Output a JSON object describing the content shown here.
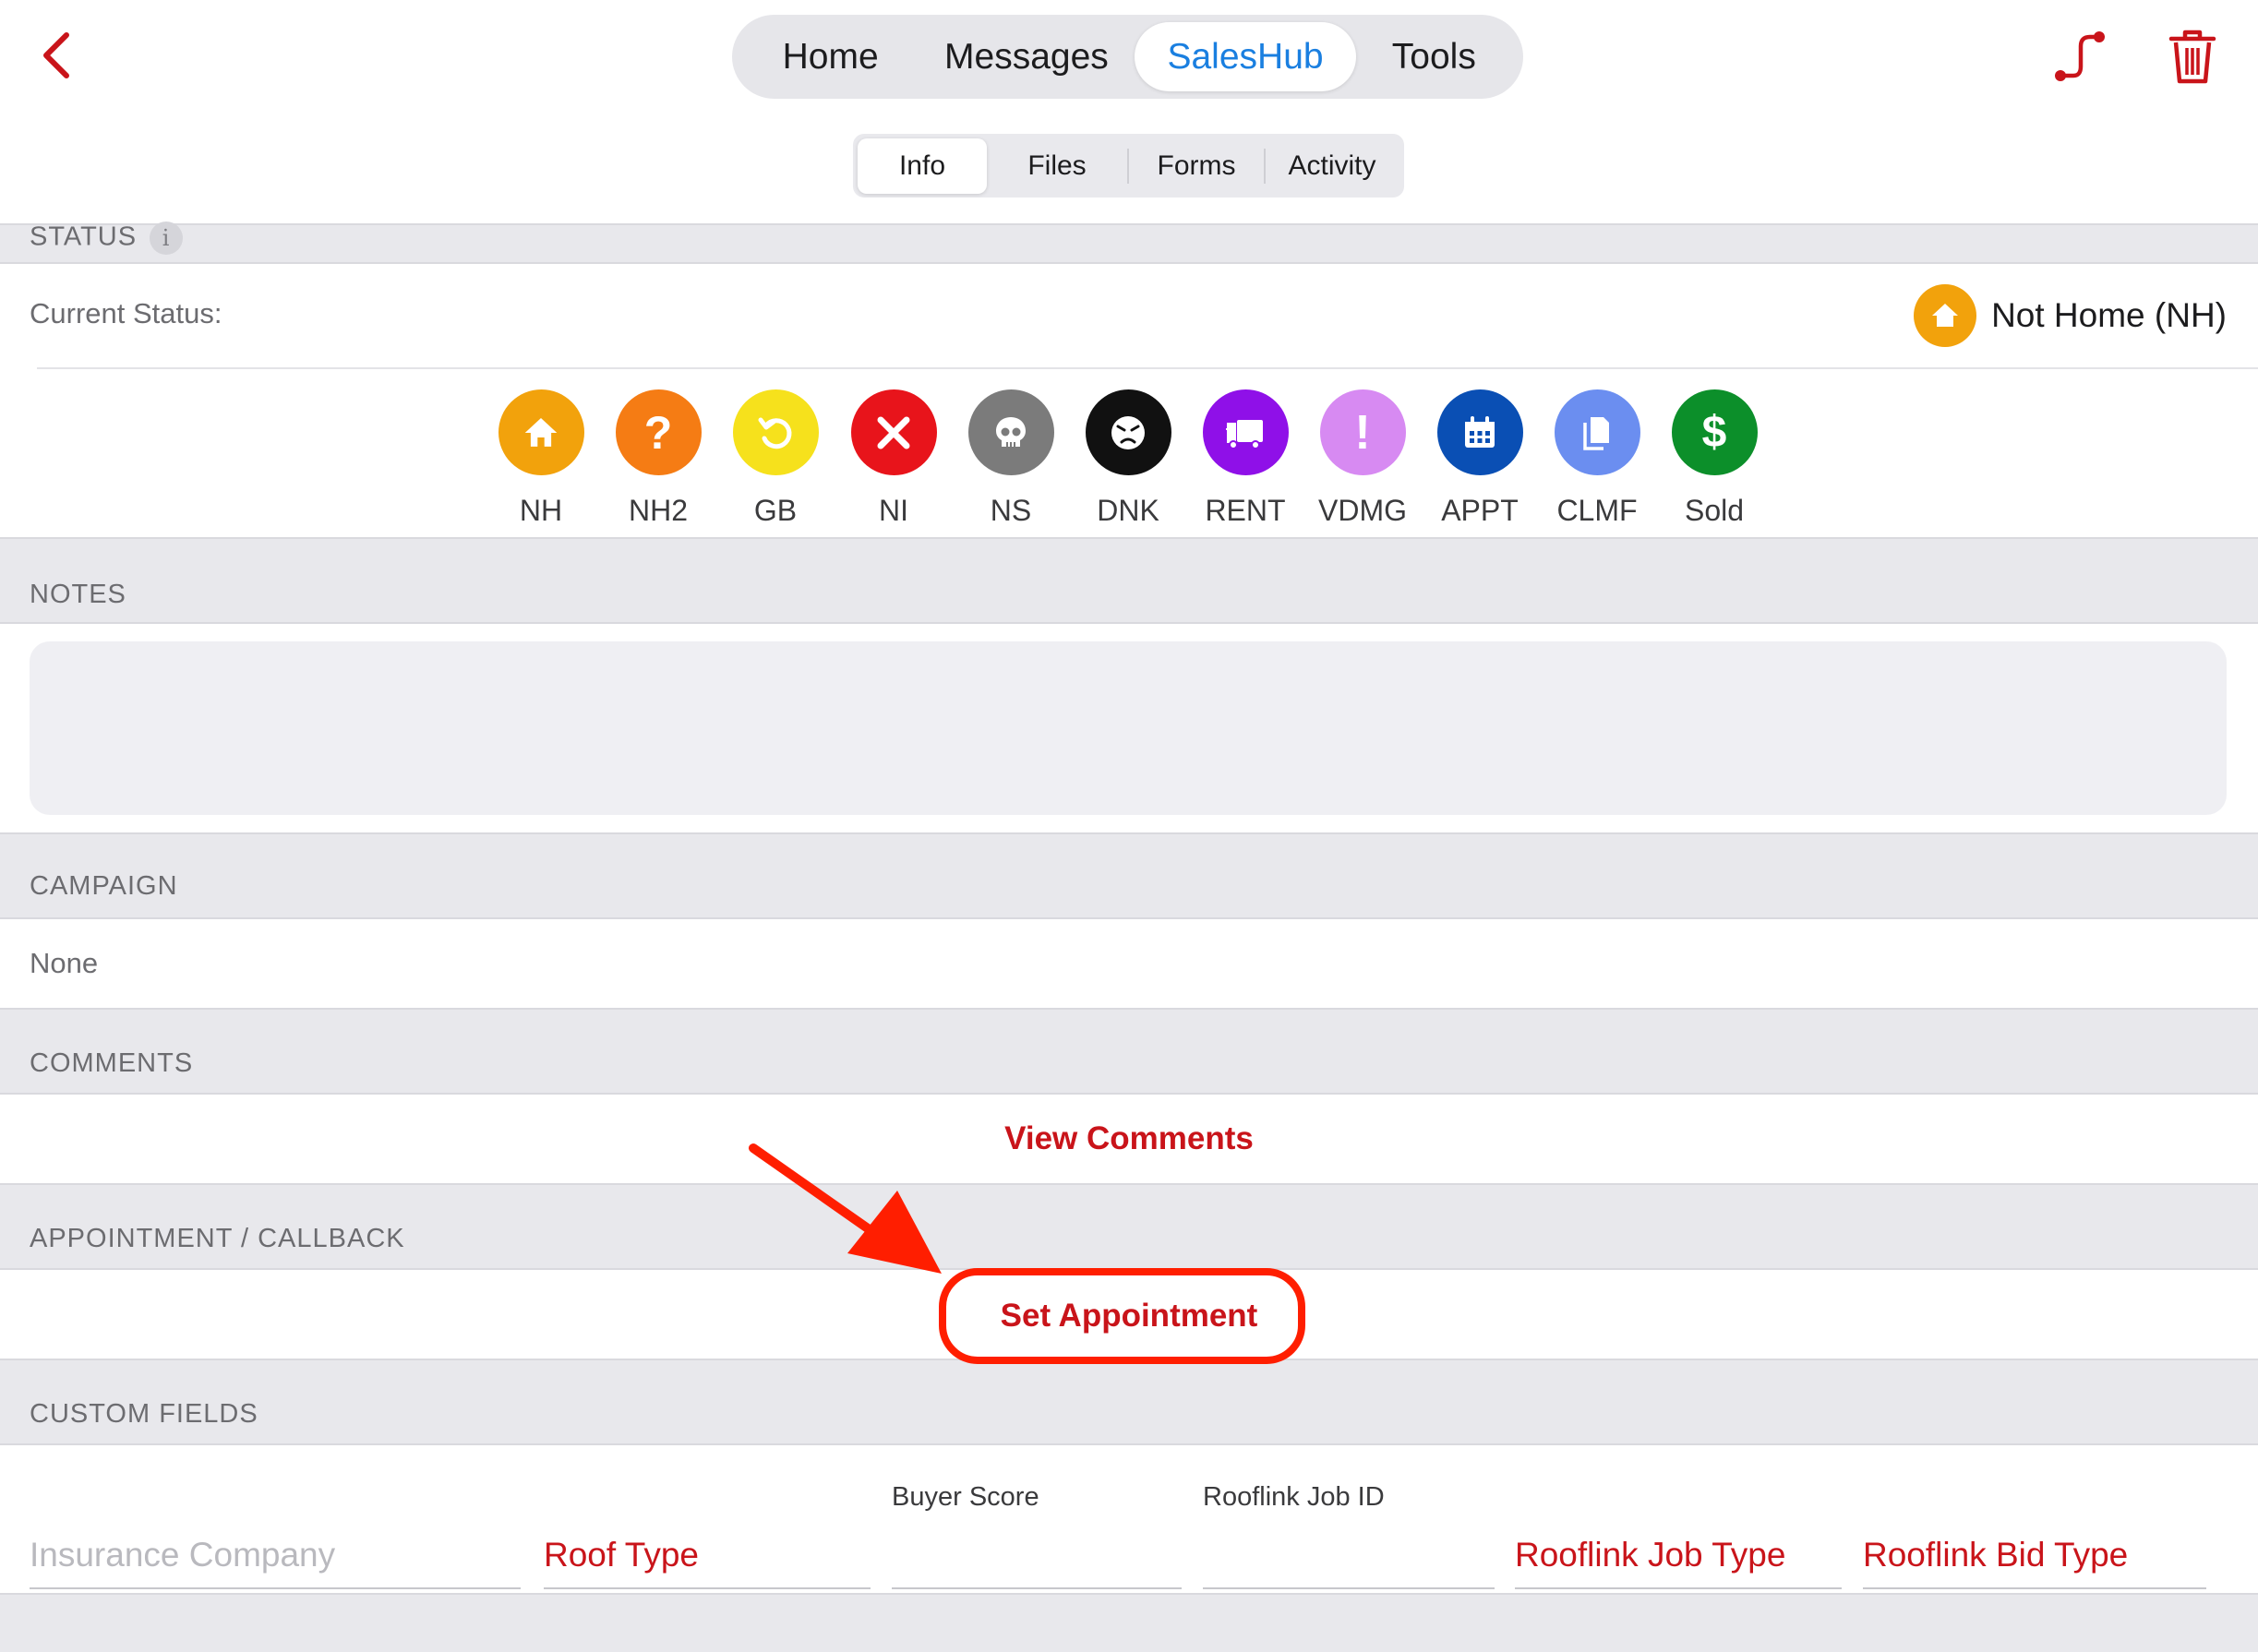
{
  "colors": {
    "accent_red": "#c9141a",
    "accent_blue": "#1a7fe0",
    "annotation": "#ff1e00"
  },
  "header": {
    "back_icon": "chevron-left-icon",
    "main_tabs": [
      {
        "label": "Home",
        "active": false
      },
      {
        "label": "Messages",
        "active": false
      },
      {
        "label": "SalesHub",
        "active": true
      },
      {
        "label": "Tools",
        "active": false
      }
    ],
    "sub_tabs": [
      {
        "label": "Info",
        "active": true
      },
      {
        "label": "Files",
        "active": false
      },
      {
        "label": "Forms",
        "active": false
      },
      {
        "label": "Activity",
        "active": false
      }
    ],
    "route_icon": "route-icon",
    "delete_icon": "trash-icon"
  },
  "status": {
    "section_label": "STATUS",
    "info_badge": "i",
    "current_label": "Current Status:",
    "current_value": "Not Home (NH)",
    "options": [
      {
        "code": "NH",
        "color": "#f2a20c",
        "icon": "home-icon"
      },
      {
        "code": "NH2",
        "color": "#f57c14",
        "icon": "question-icon"
      },
      {
        "code": "GB",
        "color": "#f6e11c",
        "icon": "refresh-icon"
      },
      {
        "code": "NI",
        "color": "#e8141b",
        "icon": "x-icon"
      },
      {
        "code": "NS",
        "color": "#7b7b7b",
        "icon": "skull-icon"
      },
      {
        "code": "DNK",
        "color": "#111111",
        "icon": "angry-face-icon"
      },
      {
        "code": "RENT",
        "color": "#8f10e8",
        "icon": "truck-icon"
      },
      {
        "code": "VDMG",
        "color": "#d78af2",
        "icon": "exclamation-icon"
      },
      {
        "code": "APPT",
        "color": "#0a4fb4",
        "icon": "calendar-icon"
      },
      {
        "code": "CLMF",
        "color": "#6b8ef0",
        "icon": "document-icon"
      },
      {
        "code": "Sold",
        "color": "#0c8f2a",
        "icon": "dollar-icon"
      }
    ]
  },
  "notes": {
    "section_label": "NOTES",
    "value": ""
  },
  "campaign": {
    "section_label": "CAMPAIGN",
    "value": "None"
  },
  "comments": {
    "section_label": "COMMENTS",
    "link": "View Comments"
  },
  "appointment": {
    "section_label": "APPOINTMENT / CALLBACK",
    "link": "Set Appointment"
  },
  "custom_fields": {
    "section_label": "CUSTOM FIELDS",
    "fields": [
      {
        "label": "",
        "placeholder": "Insurance Company"
      },
      {
        "label": "",
        "value": "Roof Type"
      },
      {
        "label": "Buyer Score",
        "value": ""
      },
      {
        "label": "Rooflink Job ID",
        "value": ""
      },
      {
        "label": "",
        "value": "Rooflink Job Type"
      },
      {
        "label": "",
        "value": "Rooflink Bid Type"
      }
    ]
  }
}
